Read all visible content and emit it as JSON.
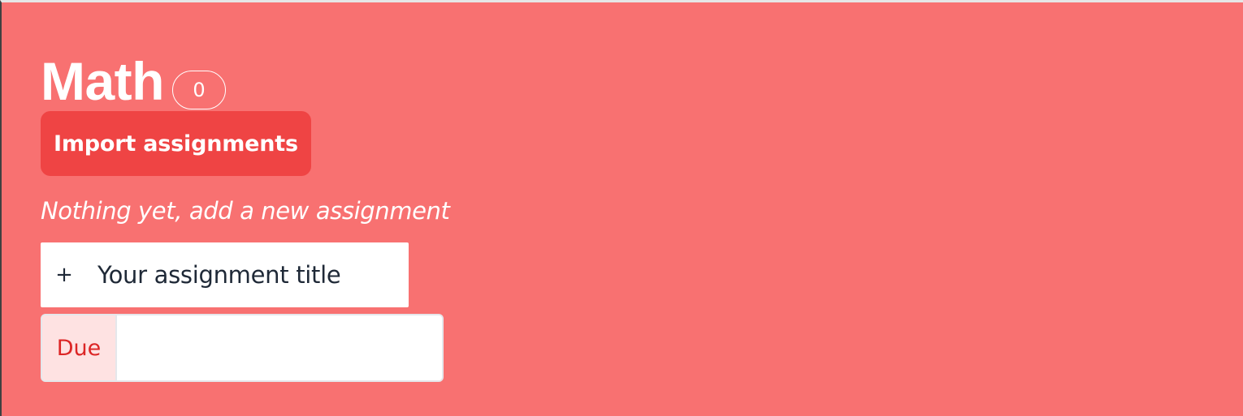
{
  "subject": {
    "title": "Math",
    "assignment_count": "0"
  },
  "import_button": {
    "label": "Import assignments"
  },
  "empty_state": {
    "message": "Nothing yet, add a new assignment"
  },
  "new_assignment": {
    "plus_glyph": "+",
    "placeholder": "Your assignment title",
    "value": ""
  },
  "due": {
    "label": "Due",
    "value": ""
  },
  "colors": {
    "background": "#f87171",
    "button": "#ef4444",
    "due_label_bg": "#fee2e2",
    "due_label_text": "#dc2626"
  },
  "icons": {
    "add": "plus-icon"
  }
}
